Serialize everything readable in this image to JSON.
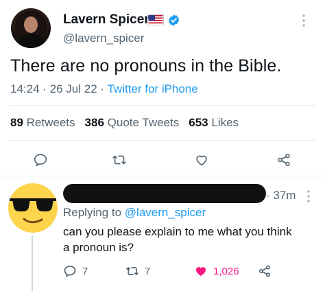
{
  "tweet": {
    "author_name": "Lavern Spicer",
    "author_handle": "@lavern_spicer",
    "text": "There are no pronouns in the Bible.",
    "time": "14:24",
    "date": "26 Jul 22",
    "source": "Twitter for iPhone",
    "separator": " · "
  },
  "stats": {
    "retweets_count": "89",
    "retweets_label": "Retweets",
    "quotes_count": "386",
    "quotes_label": "Quote Tweets",
    "likes_count": "653",
    "likes_label": "Likes"
  },
  "actions": {
    "icons": [
      "reply-icon",
      "retweet-icon",
      "like-icon",
      "share-icon"
    ]
  },
  "reply": {
    "time": "37m",
    "time_prefix": "· ",
    "replying_to_label": "Replying to",
    "replying_to_handle": "@lavern_spicer",
    "text_line1": "can you please explain to me what you think",
    "text_line2": "a pronoun is?",
    "reply_count": "7",
    "retweet_count": "7",
    "like_count": "1,026"
  },
  "colors": {
    "accent": "#1d9bf0",
    "like_pink": "#f91880",
    "muted": "#536471",
    "text": "#0f1419"
  }
}
